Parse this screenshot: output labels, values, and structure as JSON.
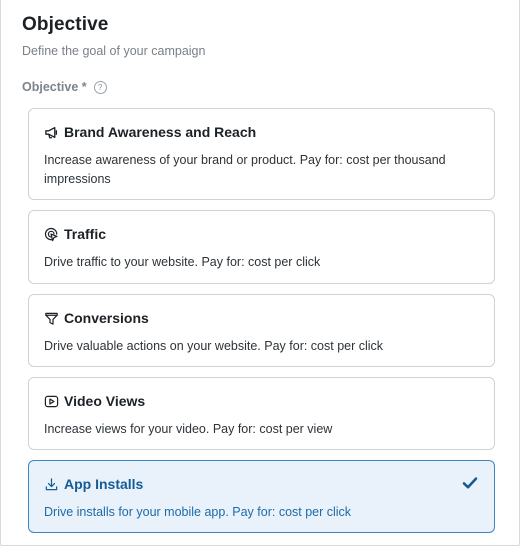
{
  "header": {
    "title": "Objective",
    "subtitle": "Define the goal of your campaign"
  },
  "field": {
    "label": "Objective *",
    "help_icon": "question-circle-icon",
    "help_glyph": "?"
  },
  "objectives": [
    {
      "title": "Brand Awareness and Reach",
      "description": "Increase awareness of your brand or product. Pay for: cost per thousand impressions",
      "icon": "megaphone-icon",
      "selected": false
    },
    {
      "title": "Traffic",
      "description": "Drive traffic to your website. Pay for: cost per click",
      "icon": "cursor-click-icon",
      "selected": false
    },
    {
      "title": "Conversions",
      "description": "Drive valuable actions on your website. Pay for: cost per click",
      "icon": "funnel-icon",
      "selected": false
    },
    {
      "title": "Video Views",
      "description": "Increase views for your video. Pay for: cost per view",
      "icon": "play-icon",
      "selected": false
    },
    {
      "title": "App Installs",
      "description": "Drive installs for your mobile app. Pay for: cost per click",
      "icon": "download-icon",
      "selected": true
    }
  ],
  "colors": {
    "selected_border": "#3e85bf",
    "selected_bg": "#e9f2fa",
    "selected_text": "#155c97",
    "card_border": "#cfd3d6"
  }
}
